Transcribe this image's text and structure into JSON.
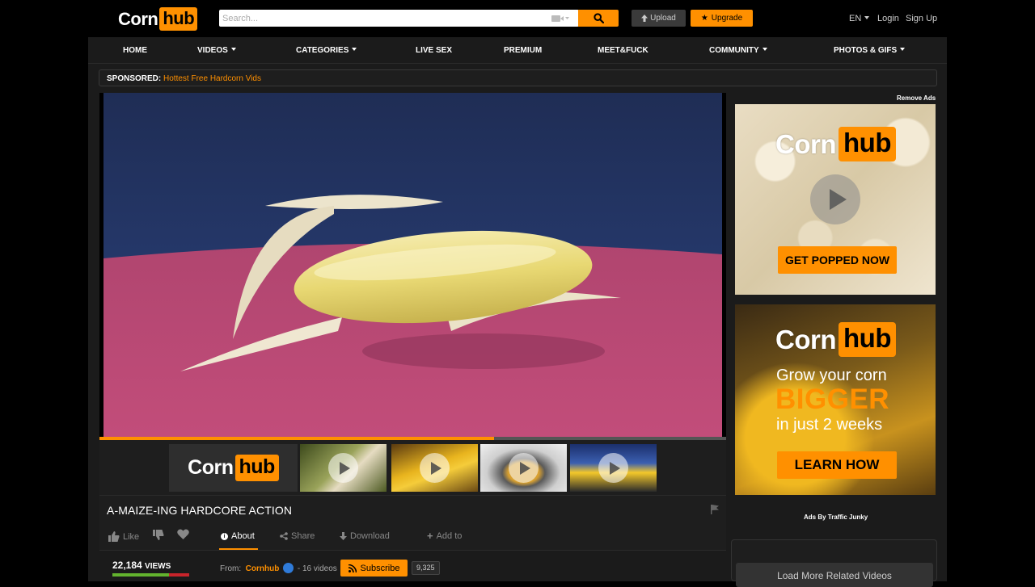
{
  "header": {
    "logo": {
      "white": "Corn",
      "orange": "hub"
    },
    "search_placeholder": "Search...",
    "upload_label": "Upload",
    "upgrade_label": "Upgrade",
    "language": "EN",
    "login_label": "Login",
    "signup_label": "Sign Up"
  },
  "nav": {
    "items": [
      {
        "label": "HOME",
        "caret": false
      },
      {
        "label": "VIDEOS",
        "caret": true
      },
      {
        "label": "CATEGORIES",
        "caret": true
      },
      {
        "label": "LIVE SEX",
        "caret": false
      },
      {
        "label": "PREMIUM",
        "caret": false
      },
      {
        "label": "MEET&FUCK",
        "caret": false
      },
      {
        "label": "COMMUNITY",
        "caret": true
      },
      {
        "label": "PHOTOS & GIFS",
        "caret": true
      }
    ]
  },
  "sponsored": {
    "label": "SPONSORED:",
    "link": "Hottest Free Hardcorn Vids"
  },
  "player": {
    "progress": 0.63
  },
  "strip": {
    "logo": {
      "white": "Corn",
      "orange": "hub"
    }
  },
  "video": {
    "title": "A-MAIZE-ING HARDCORE ACTION",
    "actions": {
      "like": "Like",
      "about": "About",
      "share": "Share",
      "download": "Download",
      "add_to": "Add to"
    },
    "views_count": "22,184",
    "views_label": "VIEWS",
    "rating": 0.74,
    "from_label": "From:",
    "channel": "Cornhub",
    "video_count": "- 16 videos",
    "subscribe_label": "Subscribe",
    "subscriber_count": "9,325"
  },
  "sidebar": {
    "remove_ads": "Remove Ads",
    "ad1": {
      "logo_white": "Corn",
      "logo_orange": "hub",
      "cta": "GET POPPED NOW"
    },
    "ad2": {
      "logo_white": "Corn",
      "logo_orange": "hub",
      "line1": "Grow your corn",
      "line2": "BIGGER",
      "line3": "in just 2 weeks",
      "cta": "LEARN HOW"
    },
    "ads_by": "Ads By Traffic Junky",
    "load_more": "Load More Related Videos"
  },
  "colors": {
    "accent": "#ff9000",
    "background": "#1b1b1b",
    "header": "#000000"
  }
}
